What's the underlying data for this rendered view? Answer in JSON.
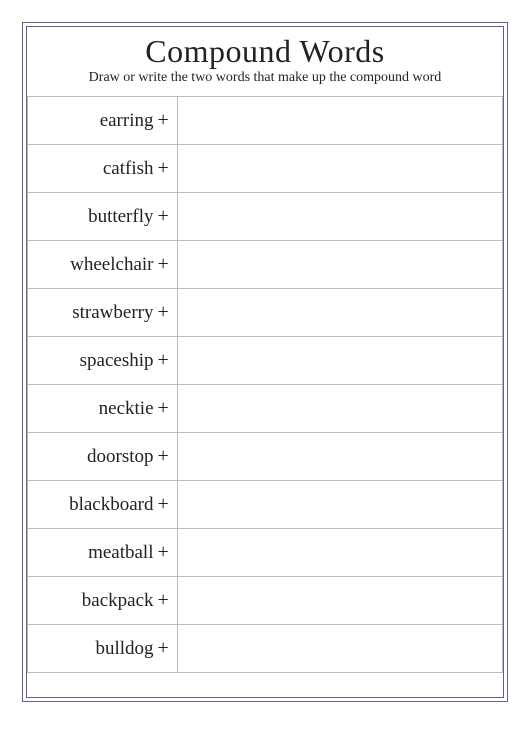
{
  "title": "Compound Words",
  "subtitle": "Draw or write the two words that make up the compound word",
  "plus": "+",
  "words": [
    "earring",
    "catfish",
    "butterfly",
    "wheelchair",
    "strawberry",
    "spaceship",
    "necktie",
    "doorstop",
    "blackboard",
    "meatball",
    "backpack",
    "bulldog"
  ]
}
